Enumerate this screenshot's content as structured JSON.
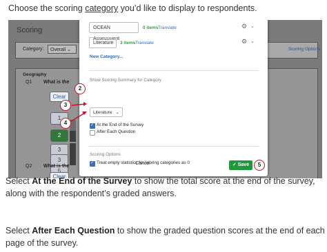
{
  "intro": {
    "before": "Choose the scoring ",
    "link": "category",
    "after": " you’d like to display to respondents."
  },
  "background": {
    "scoring_title": "Scoring",
    "category_label": "Category:",
    "category_value": "Overall",
    "scoring_options": "Scoring Options",
    "geography": "Geography",
    "q1": "Q1",
    "q1_text": "What is the",
    "q2": "Q2",
    "q2_text": "What is the",
    "clear1": "Clear",
    "clear2": "Clear",
    "num1": "1",
    "num2": "2",
    "num3": "3",
    "num4": "3",
    "num5": "5"
  },
  "modal": {
    "categories": [
      {
        "name": "OCEAN Assessment",
        "items": "0 items",
        "translate": "Translate"
      },
      {
        "name": "Literature",
        "items": "3 items",
        "translate": "Translate"
      }
    ],
    "new_category": "New Category...",
    "summary_label": "Show Scoring Summary for Category",
    "category_select": "Literature",
    "opt_end": "At the End of the Survey",
    "opt_each": "After Each Question",
    "scoring_options_label": "Scoring Options",
    "treat_empty": "Treat empty statistics for scoring categories as 0",
    "cancel": "Cancel",
    "save": "Save"
  },
  "markers": [
    "2",
    "3",
    "4",
    "5"
  ],
  "para1": {
    "before": "Select ",
    "bold": "At the End of the Survey",
    "after": " to show the total score at the end of the survey, along with the respondent’s graded answers."
  },
  "para2": {
    "before": "Select ",
    "bold": "After Each Question",
    "after": " to show the graded question scores at the end of each page of the survey."
  },
  "colors": {
    "accent": "#c8102e",
    "save": "#1e9a3a",
    "link": "#2a6fb0"
  }
}
